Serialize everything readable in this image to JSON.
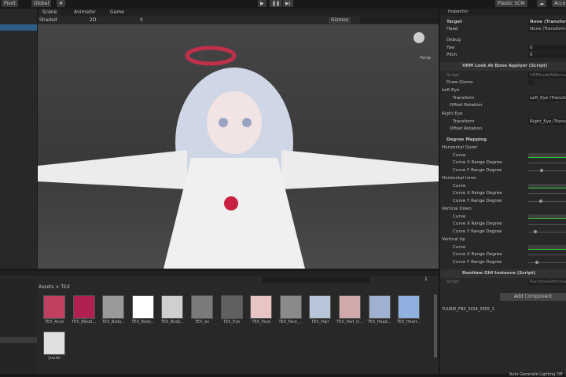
{
  "toolbar": {
    "pivot": "Pivot",
    "global": "Global",
    "play": "▶",
    "pause": "❚❚",
    "step": "▶|",
    "plastic": "Plastic SCM",
    "account": "Acco"
  },
  "scene": {
    "tabs": [
      "Scene",
      "Animator",
      "Game"
    ],
    "shading": "Shaded",
    "mode2d": "2D",
    "gizmos": "Gizmos",
    "persp": "Persp",
    "layers_count": "0"
  },
  "inspector": {
    "title": "Inspector",
    "top_rows": [
      {
        "label": "Target",
        "value": "None (Transform)",
        "bold": true
      },
      {
        "label": "Head",
        "value": "None (Transform)"
      }
    ],
    "debug": {
      "title": "Debug",
      "rows": [
        {
          "label": "Yaw",
          "value": "0"
        },
        {
          "label": "Pitch",
          "value": "0"
        }
      ]
    },
    "component1": {
      "title": "VRM Look At Bone Applyer (Script)",
      "script_label": "Script",
      "script_value": "VRMLookAtBoneApplyer",
      "draw_gizmo": "Draw Gizmo",
      "left_eye": "Left Eye",
      "right_eye": "Right Eye",
      "transform": "Transform",
      "left_value": "Left_Eye (Transform)",
      "right_value": "Right_Eye (Transform)",
      "offset": "Offset Rotation"
    },
    "degree": {
      "title": "Degree Mapping",
      "groups": [
        {
          "name": "Horizontal Outer",
          "curve": "Curve",
          "x": "Curve X Range Degree",
          "y": "Curve Y Range Degree",
          "y_level": 0.35
        },
        {
          "name": "Horizontal Inner",
          "curve": "Curve",
          "x": "Curve X Range Degree",
          "y": "Curve Y Range Degree",
          "y_level": 0.32
        },
        {
          "name": "Vertical Down",
          "curve": "Curve",
          "x": "Curve X Range Degree",
          "y": "Curve Y Range Degree",
          "y_level": 0.15
        },
        {
          "name": "Vertical Up",
          "curve": "Curve",
          "x": "Curve X Range Degree",
          "y": "Curve Y Range Degree",
          "y_level": 0.2
        }
      ]
    },
    "component2": {
      "title": "Runtime Gltf Instance (Script)",
      "script_label": "Script",
      "script_value": "RuntimeGltfInstance"
    },
    "add_component": "Add Component",
    "preview_title": "YUUREI_FBX_2024_0305_1"
  },
  "project": {
    "breadcrumb": [
      "Assets",
      "TEX"
    ],
    "hidden_count": "1",
    "assets": [
      {
        "name": "TEX_Acce",
        "color": "#c04060"
      },
      {
        "name": "TEX_Blood...",
        "color": "#b02050"
      },
      {
        "name": "TEX_Body...",
        "color": "#9a9a9a"
      },
      {
        "name": "TEX_Body...",
        "color": "#ffffff"
      },
      {
        "name": "TEX_Body...",
        "color": "#cfcfcf"
      },
      {
        "name": "TEX_ex",
        "color": "#7a7a7a"
      },
      {
        "name": "TEX_Eye",
        "color": "#606060"
      },
      {
        "name": "TEX_Face",
        "color": "#e8c4c4"
      },
      {
        "name": "TEX_Face_...",
        "color": "#8a8a8a"
      },
      {
        "name": "TEX_Hair",
        "color": "#b8c4d8"
      },
      {
        "name": "TEX_Hair_D...",
        "color": "#d0aaaa"
      },
      {
        "name": "TEX_Head...",
        "color": "#a0b0d0"
      },
      {
        "name": "TEX_Heart...",
        "color": "#90b0e0"
      },
      {
        "name": "yuurei",
        "color": "#e0e0e0"
      }
    ]
  },
  "status": {
    "lighting": "Auto Generate Lighting Off"
  }
}
